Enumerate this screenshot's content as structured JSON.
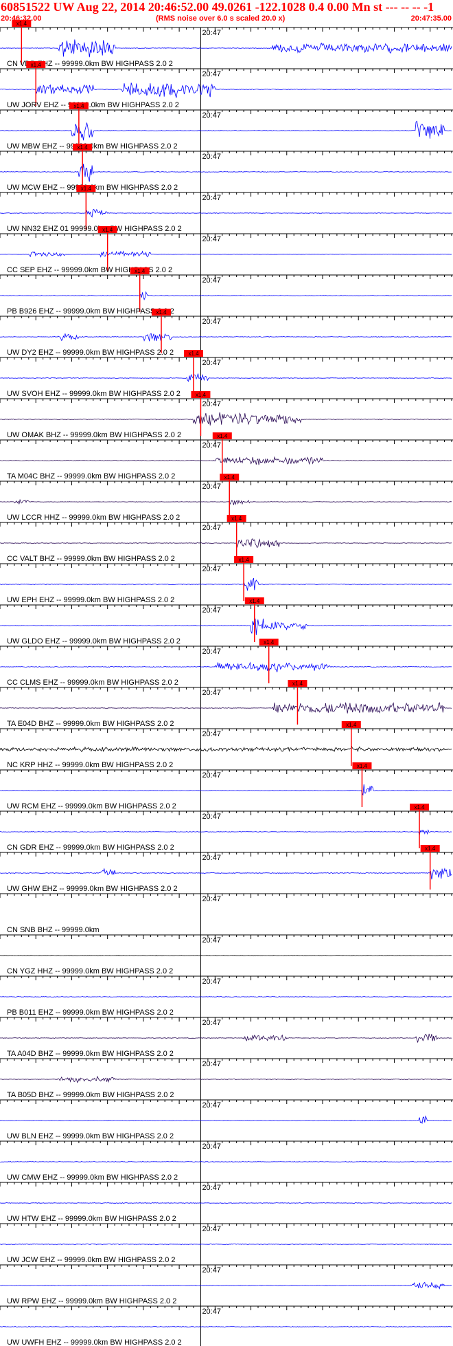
{
  "header": {
    "title": "60851522 UW Aug 22, 2014 20:46:52.00   49.0261 -122.1028  0.4 0.00 Mn st --- -- --  -1",
    "start_time": "20:46:32.00",
    "noise_note": "(RMS noise over 6.0 s scaled 20.0 x)",
    "end_time": "20:47:35.00"
  },
  "colors": {
    "title": "#ff0000",
    "trace_blue": "#0000ff",
    "trace_dark": "#2a0a55",
    "trace_black": "#000000",
    "pick_box": "#ff0000",
    "pick_line": "#ff0000"
  },
  "minute_label": "20:47",
  "pick_label": "x1.4",
  "chart_data": {
    "type": "seismogram",
    "time_range": [
      "20:46:32.00",
      "20:47:35.00"
    ],
    "minute_mark": "20:47",
    "channels": [
      {
        "label": "CN VDB EHZ -- 99999.0km BW  HIGHPASS  2.0  2",
        "color": "blue",
        "pick_s": 3,
        "amp": 0.35,
        "bursts": [
          [
            8,
            16,
            6
          ],
          [
            38,
            63,
            3
          ]
        ]
      },
      {
        "label": "UW JORV EHZ -- 99999.0km BW  HIGHPASS  2.0  2",
        "color": "blue",
        "pick_s": 5,
        "amp": 0.45,
        "bursts": [
          [
            5,
            13,
            3
          ],
          [
            17,
            30,
            5
          ]
        ]
      },
      {
        "label": "UW MBW EHZ -- 99999.0km BW  HIGHPASS  2.0  2",
        "color": "blue",
        "pick_s": 11,
        "amp": 0.35,
        "bursts": [
          [
            10,
            13,
            6
          ],
          [
            58,
            62,
            6
          ]
        ]
      },
      {
        "label": "UW MCW EHZ -- 99999.0km BW  HIGHPASS  2.0  2",
        "color": "blue",
        "pick_s": 11.5,
        "amp": 0.35,
        "bursts": [
          [
            11,
            13,
            7
          ]
        ]
      },
      {
        "label": "UW NN32 EHZ 01 99999.0km BW  HIGHPASS  2.0  2",
        "color": "blue",
        "pick_s": 12,
        "amp": 0.3,
        "bursts": [
          [
            12,
            15,
            3
          ]
        ]
      },
      {
        "label": "CC SEP EHZ -- 99999.0km BW  HIGHPASS  2.0  2",
        "color": "blue",
        "pick_s": 15,
        "amp": 0.1,
        "bursts": [
          [
            4,
            9,
            2
          ],
          [
            14,
            21,
            2
          ]
        ]
      },
      {
        "label": "PB B926 EHZ -- 99999.0km BW  HIGHPASS  2.0  2",
        "color": "blue",
        "pick_s": 19.5,
        "amp": 0.3,
        "bursts": [
          [
            19.5,
            20.5,
            5
          ]
        ]
      },
      {
        "label": "UW DY2 EHZ -- 99999.0km BW  HIGHPASS  2.0  2",
        "color": "blue",
        "pick_s": 22.5,
        "amp": 0.35,
        "bursts": [
          [
            8,
            11,
            2
          ],
          [
            20,
            24,
            3
          ]
        ]
      },
      {
        "label": "UW SVOH EHZ -- 99999.0km BW  HIGHPASS  2.0  2",
        "color": "blue",
        "pick_s": 27,
        "amp": 0.35,
        "bursts": [
          [
            26,
            29,
            2.5
          ]
        ]
      },
      {
        "label": "UW OMAK BHZ -- 99999.0km BW  HIGHPASS  2.0  2",
        "color": "dark",
        "pick_s": 28,
        "amp": 0.35,
        "bursts": [
          [
            27,
            42,
            4
          ]
        ]
      },
      {
        "label": "TA M04C BHZ -- 99999.0km BW  HIGHPASS  2.0  2",
        "color": "dark",
        "pick_s": 31,
        "amp": 0.4,
        "bursts": [
          [
            30,
            45,
            2.5
          ]
        ]
      },
      {
        "label": "UW LCCR HHZ -- 99999.0km BW  HIGHPASS  2.0  2",
        "color": "dark",
        "pick_s": 32,
        "amp": 0.25,
        "bursts": [
          [
            2,
            4,
            2
          ],
          [
            32,
            35,
            2
          ]
        ]
      },
      {
        "label": "CC VALT BHZ -- 99999.0km BW  HIGHPASS  2.0  2",
        "color": "dark",
        "pick_s": 33,
        "amp": 0.35,
        "bursts": [
          [
            33,
            39,
            3
          ]
        ]
      },
      {
        "label": "UW EPH EHZ -- 99999.0km BW  HIGHPASS  2.0  2",
        "color": "blue",
        "pick_s": 34,
        "amp": 0.35,
        "bursts": [
          [
            34,
            36,
            5
          ]
        ]
      },
      {
        "label": "UW GLDO EHZ -- 99999.0km BW  HIGHPASS  2.0  2",
        "color": "blue",
        "pick_s": 35.5,
        "amp": 0.4,
        "bursts": [
          [
            35,
            37,
            5
          ],
          [
            37,
            43,
            2.5
          ]
        ]
      },
      {
        "label": "CC CLMS EHZ -- 99999.0km BW  HIGHPASS  2.0  2",
        "color": "blue",
        "pick_s": 37.5,
        "amp": 0.45,
        "bursts": [
          [
            30,
            46,
            2.5
          ],
          [
            37.5,
            39,
            4
          ]
        ]
      },
      {
        "label": "TA E04D BHZ -- 99999.0km BW  HIGHPASS  2.0  2",
        "color": "dark",
        "pick_s": 41.5,
        "amp": 0.35,
        "bursts": [
          [
            38,
            62,
            3.5
          ]
        ]
      },
      {
        "label": "NC KRP HHZ -- 99999.0km BW  HIGHPASS  2.0  2",
        "color": "black",
        "pick_s": 49,
        "amp": 0.45,
        "bursts": [
          [
            0,
            62,
            1.2
          ],
          [
            49,
            51,
            1.5
          ]
        ]
      },
      {
        "label": "UW RCM EHZ -- 99999.0km BW  HIGHPASS  2.0  2",
        "color": "blue",
        "pick_s": 50.5,
        "amp": 0.35,
        "bursts": [
          [
            50.5,
            52,
            4
          ]
        ]
      },
      {
        "label": "CN GDR EHZ -- 99999.0km BW  HIGHPASS  2.0  2",
        "color": "blue",
        "pick_s": 58.5,
        "amp": 0.35,
        "bursts": [
          [
            58.5,
            60,
            2
          ]
        ]
      },
      {
        "label": "UW GHW EHZ -- 99999.0km BW  HIGHPASS  2.0  2",
        "color": "blue",
        "pick_s": 60,
        "amp": 0.45,
        "bursts": [
          [
            14,
            16,
            4
          ],
          [
            60,
            63,
            4
          ]
        ]
      },
      {
        "label": "CN SNB BHZ -- 99999.0km",
        "color": "blue",
        "pick_s": null,
        "amp": 0,
        "bursts": []
      },
      {
        "label": "CN YGZ HHZ -- 99999.0km BW  HIGHPASS  2.0  2",
        "color": "black",
        "pick_s": null,
        "amp": 0.35,
        "bursts": []
      },
      {
        "label": "PB B011 EHZ -- 99999.0km BW  HIGHPASS  2.0  2",
        "color": "blue",
        "pick_s": null,
        "amp": 0.35,
        "bursts": []
      },
      {
        "label": "TA A04D BHZ -- 99999.0km BW  HIGHPASS  2.0  2",
        "color": "dark",
        "pick_s": null,
        "amp": 0.35,
        "bursts": [
          [
            34,
            40,
            2
          ],
          [
            58,
            61,
            3
          ]
        ]
      },
      {
        "label": "TA B05D BHZ -- 99999.0km BW  HIGHPASS  2.0  2",
        "color": "dark",
        "pick_s": null,
        "amp": 0.35,
        "bursts": [
          [
            8,
            16,
            1.8
          ]
        ]
      },
      {
        "label": "UW BLN EHZ -- 99999.0km BW  HIGHPASS  2.0  2",
        "color": "blue",
        "pick_s": null,
        "amp": 0.35,
        "bursts": [
          [
            58.5,
            59.5,
            4
          ]
        ]
      },
      {
        "label": "UW CMW EHZ -- 99999.0km BW  HIGHPASS  2.0  2",
        "color": "blue",
        "pick_s": null,
        "amp": 0.35,
        "bursts": []
      },
      {
        "label": "UW HTW EHZ -- 99999.0km BW  HIGHPASS  2.0  2",
        "color": "blue",
        "pick_s": null,
        "amp": 0.35,
        "bursts": []
      },
      {
        "label": "UW JCW EHZ -- 99999.0km BW  HIGHPASS  2.0  2",
        "color": "blue",
        "pick_s": null,
        "amp": 0.35,
        "bursts": []
      },
      {
        "label": "UW RPW EHZ -- 99999.0km BW  HIGHPASS  2.0  2",
        "color": "blue",
        "pick_s": null,
        "amp": 0.35,
        "bursts": [
          [
            57,
            62,
            2
          ]
        ]
      },
      {
        "label": "UW UWFH EHZ -- 99999.0km BW  HIGHPASS  2.0  2",
        "color": "blue",
        "pick_s": null,
        "amp": 0.35,
        "bursts": []
      }
    ]
  }
}
